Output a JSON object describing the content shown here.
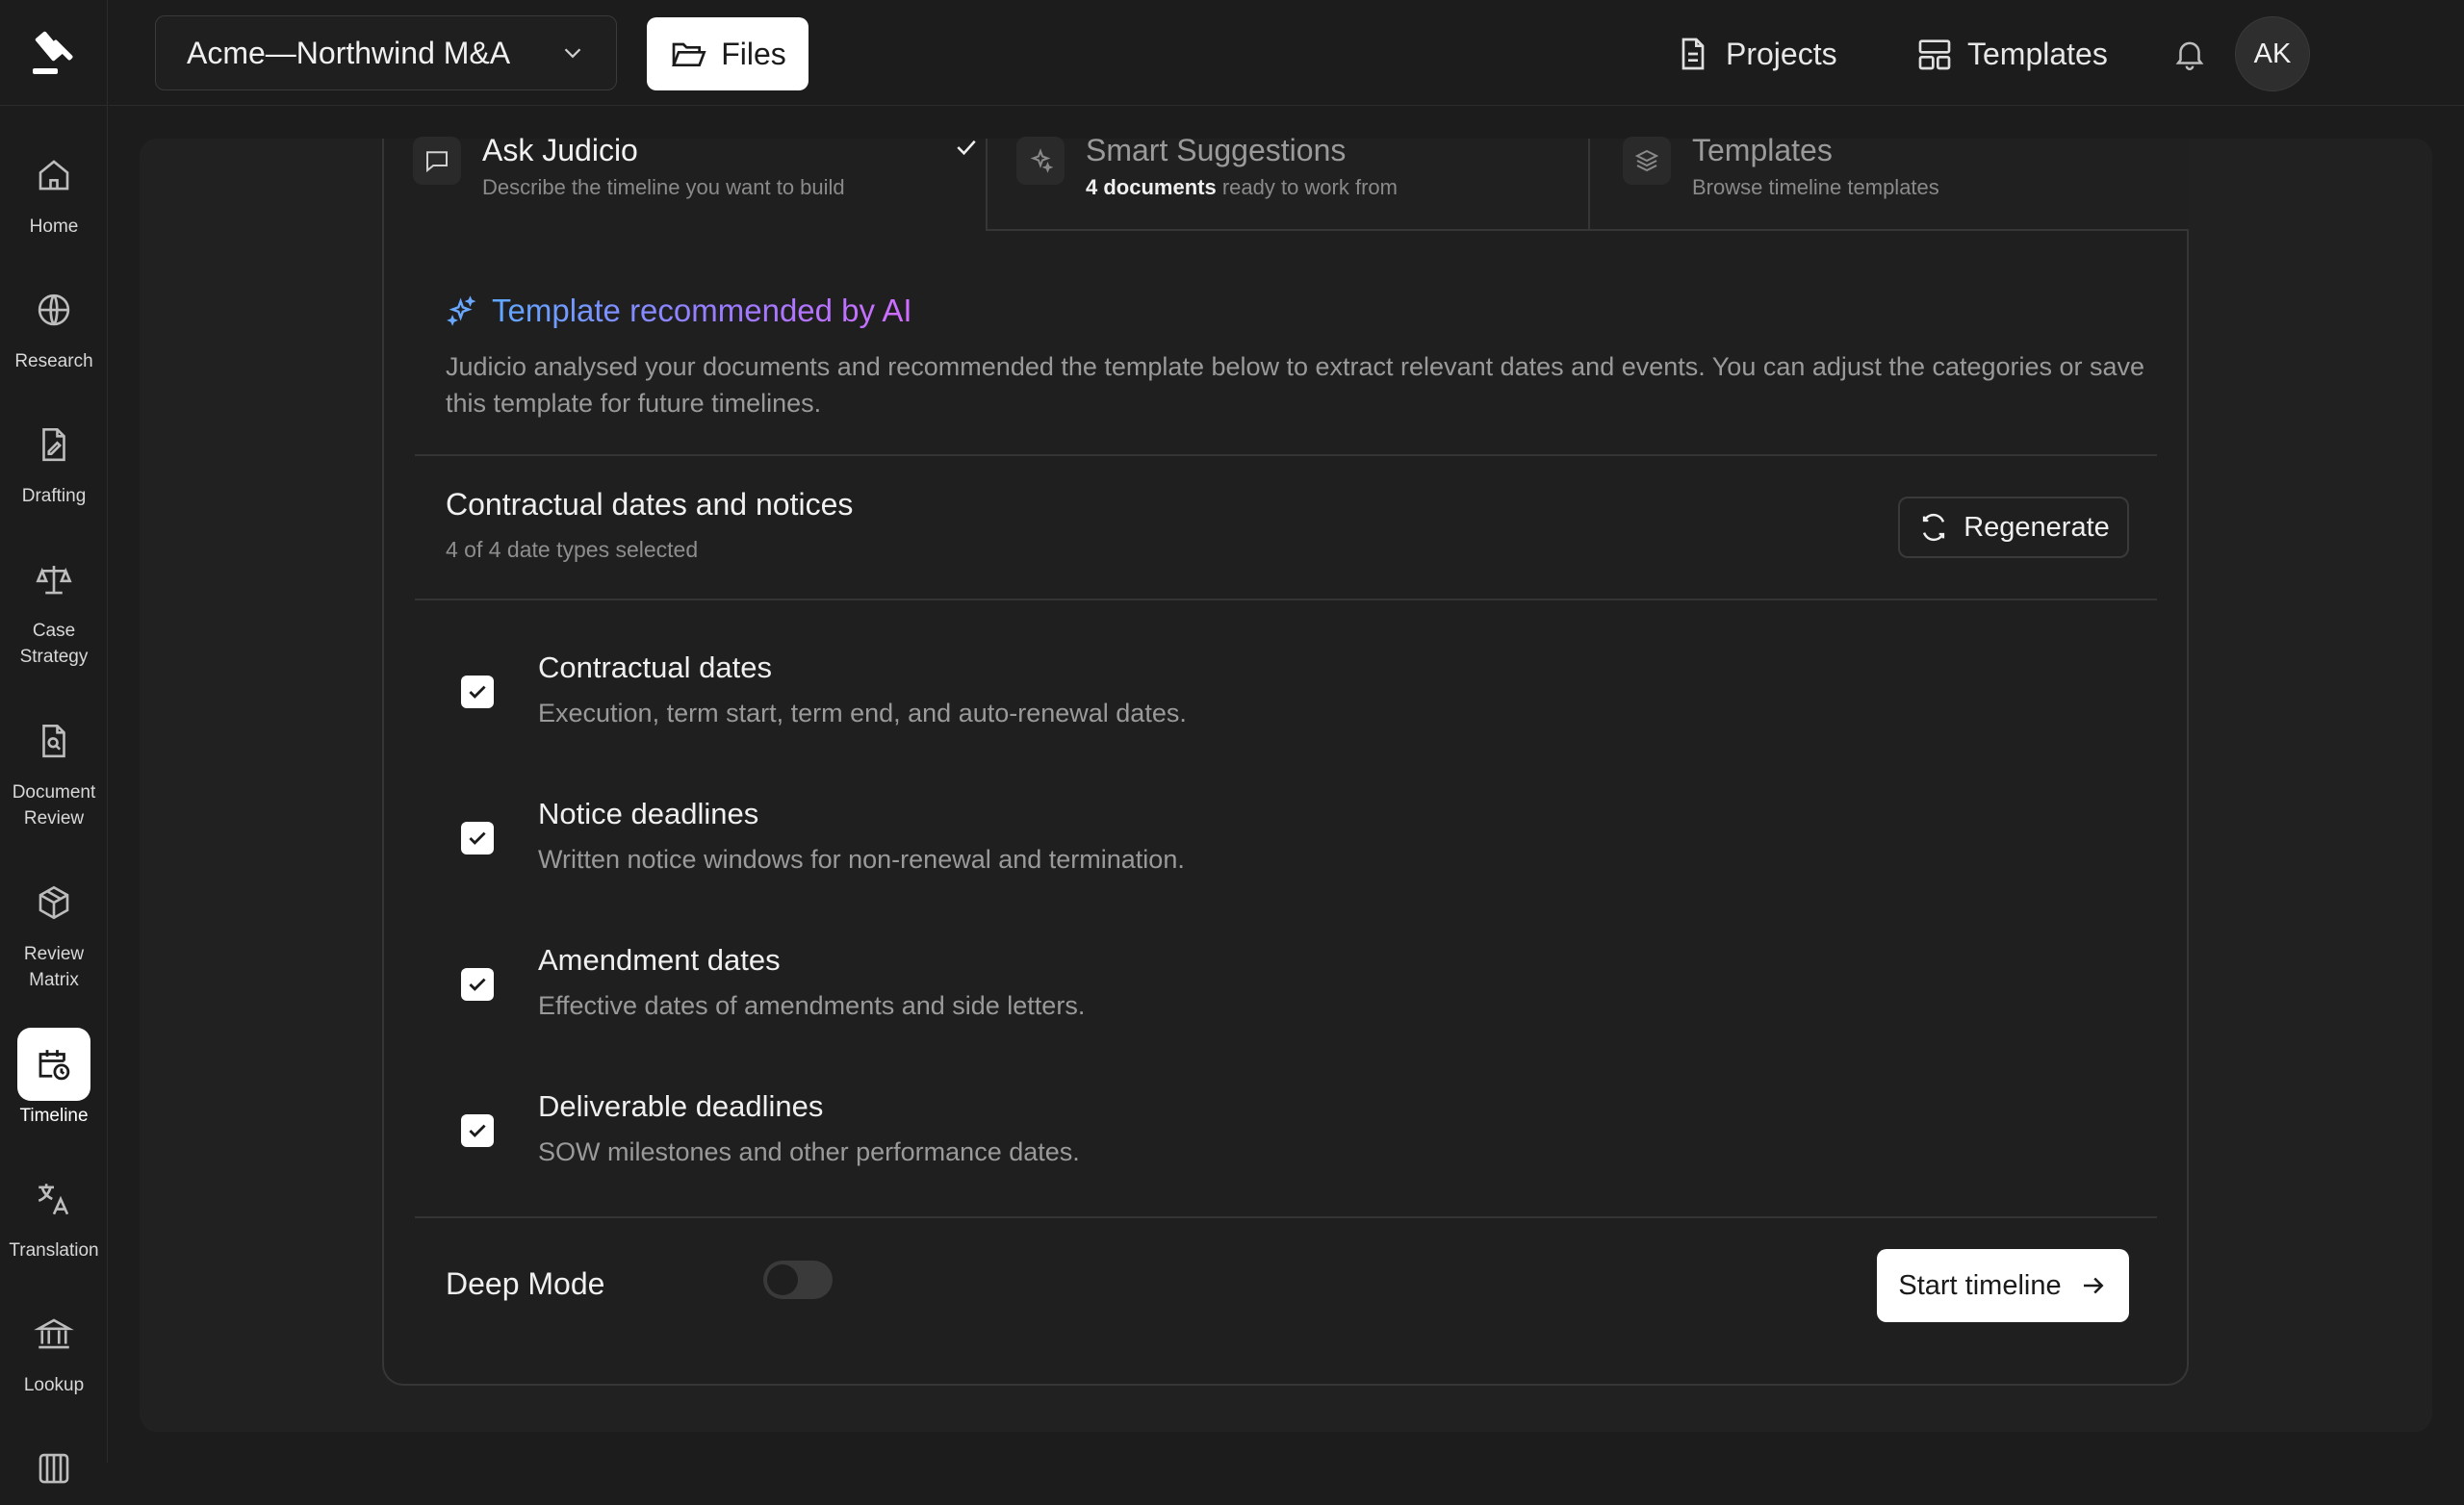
{
  "app": {
    "project_name": "Acme—Northwind M&A",
    "files_label": "Files",
    "projects_label": "Projects",
    "templates_label": "Templates",
    "user_initials": "AK"
  },
  "sidebar": {
    "items": [
      {
        "label": "Home",
        "icon": "home-icon"
      },
      {
        "label": "Research",
        "icon": "globe-icon"
      },
      {
        "label": "Drafting",
        "icon": "pen-document-icon"
      },
      {
        "label": "Case Strategy",
        "icon": "scales-icon"
      },
      {
        "label": "Document Review",
        "icon": "document-search-icon"
      },
      {
        "label": "Review Matrix",
        "icon": "cube-icon"
      },
      {
        "label": "Timeline",
        "icon": "calendar-clock-icon",
        "active": true
      },
      {
        "label": "Translation",
        "icon": "translate-icon"
      },
      {
        "label": "Lookup",
        "icon": "bank-icon"
      }
    ]
  },
  "tabs": [
    {
      "title": "Ask Judicio",
      "subtitle": "Describe the timeline you want to build",
      "active": true
    },
    {
      "title": "Smart Suggestions",
      "subtitle_bold": "4 documents",
      "subtitle": " ready to work from"
    },
    {
      "title": "Templates",
      "subtitle": "Browse timeline templates"
    }
  ],
  "recommendation": {
    "title": "Template recommended by AI",
    "description": "Judicio analysed your documents and recommended the template below to extract relevant dates and events. You can adjust the categories or save this template for future timelines."
  },
  "template": {
    "name": "Contractual dates and notices",
    "selected_count": "4 of 4 date types selected",
    "regenerate_label": "Regenerate"
  },
  "categories": [
    {
      "title": "Contractual dates",
      "description": "Execution, term start, term end, and auto-renewal dates.",
      "checked": true
    },
    {
      "title": "Notice deadlines",
      "description": "Written notice windows for non-renewal and termination.",
      "checked": true
    },
    {
      "title": "Amendment dates",
      "description": "Effective dates of amendments and side letters.",
      "checked": true
    },
    {
      "title": "Deliverable deadlines",
      "description": "SOW milestones and other performance dates.",
      "checked": true
    }
  ],
  "footer": {
    "deep_mode_label": "Deep Mode",
    "deep_mode_on": false,
    "start_label": "Start timeline"
  },
  "colors": {
    "background": "#1c1c1c",
    "accent_gradient_start": "#5fa8ff",
    "accent_gradient_end": "#d26cff"
  }
}
